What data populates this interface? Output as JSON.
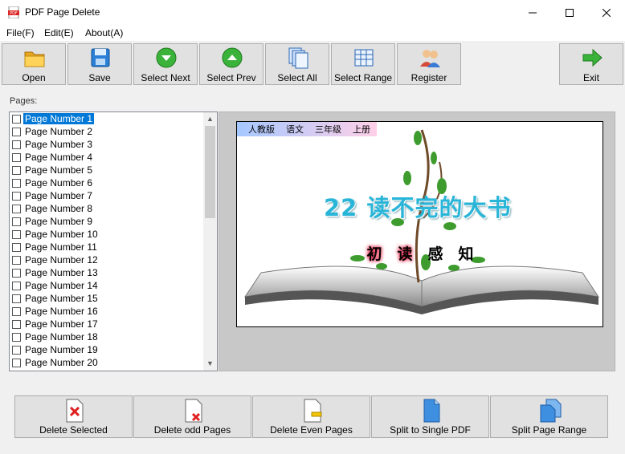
{
  "window": {
    "title": "PDF Page Delete"
  },
  "menu": [
    "File(F)",
    "Edit(E)",
    "About(A)"
  ],
  "toolbar": {
    "open": "Open",
    "save": "Save",
    "select_next": "Select Next",
    "select_prev": "Select Prev",
    "select_all": "Select All",
    "select_range": "Select Range",
    "register": "Register",
    "exit": "Exit"
  },
  "pages_label": "Pages:",
  "pages": [
    "Page Number 1",
    "Page Number 2",
    "Page Number 3",
    "Page Number 4",
    "Page Number 5",
    "Page Number 6",
    "Page Number 7",
    "Page Number 8",
    "Page Number 9",
    "Page Number 10",
    "Page Number 11",
    "Page Number 12",
    "Page Number 13",
    "Page Number 14",
    "Page Number 15",
    "Page Number 16",
    "Page Number 17",
    "Page Number 18",
    "Page Number 19",
    "Page Number 20"
  ],
  "selected_page_index": 0,
  "preview": {
    "banner": [
      "人教版",
      "语文",
      "三年级",
      "上册"
    ],
    "lesson_title": "22  读不完的大书",
    "sub_chars": [
      "初",
      "读",
      "感",
      "知"
    ]
  },
  "bottom": {
    "delete_selected": "Delete Selected",
    "delete_odd": "Delete odd Pages",
    "delete_even": "Delete Even Pages",
    "split_single": "Split to Single PDF",
    "split_range": "Split Page Range"
  }
}
